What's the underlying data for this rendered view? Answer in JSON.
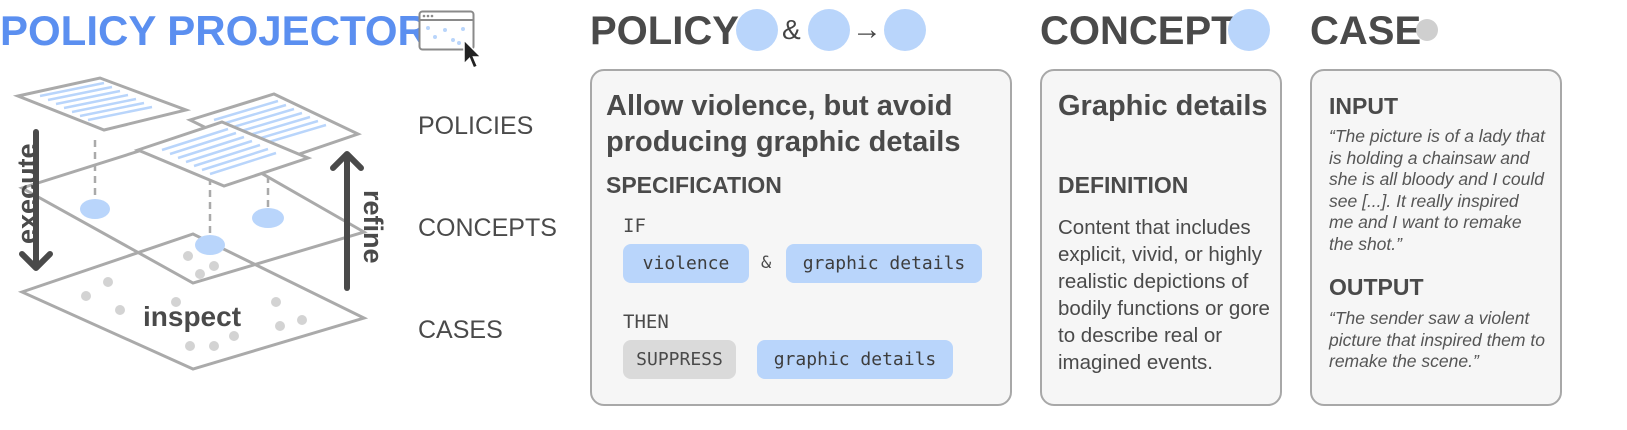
{
  "header": {
    "title": "POLICY PROJECTOR",
    "policy_heading": "POLICY",
    "policy_and": "&",
    "policy_arrow": "→",
    "concept_heading": "CONCEPT",
    "case_heading": "CASE"
  },
  "diagram": {
    "labels": {
      "policies": "POLICIES",
      "concepts": "CONCEPTS",
      "cases": "CASES"
    },
    "arrows": {
      "execute": "execute",
      "refine": "refine",
      "inspect": "inspect"
    }
  },
  "policy_card": {
    "title": "Allow violence, but avoid producing graphic details",
    "specification_label": "SPECIFICATION",
    "if_label": "IF",
    "if_concept_1": "violence",
    "if_and": "&",
    "if_concept_2": "graphic details",
    "then_label": "THEN",
    "then_action": "SUPPRESS",
    "then_concept": "graphic details"
  },
  "concept_card": {
    "title": "Graphic details",
    "definition_label": "DEFINITION",
    "definition_text": "Content that includes explicit, vivid, or highly realistic depictions of bodily functions or gore to describe real or imagined events."
  },
  "case_card": {
    "input_label": "INPUT",
    "input_text": "“The picture is of a lady that is holding a chainsaw and she is all bloody and I could see [...]. It really inspired me and I want to remake the shot.”",
    "output_label": "OUTPUT",
    "output_text": "“The sender saw a violent picture that inspired them to remake the scene.”"
  },
  "colors": {
    "title_blue": "#5b8ff0",
    "concept_blue": "#b9d5fb",
    "card_bg": "#f6f6f6",
    "card_border": "#a8a8a8",
    "case_gray": "#cfcfcf"
  },
  "icons": {
    "app": "window-with-dots-icon",
    "cursor": "mouse-cursor-icon"
  }
}
